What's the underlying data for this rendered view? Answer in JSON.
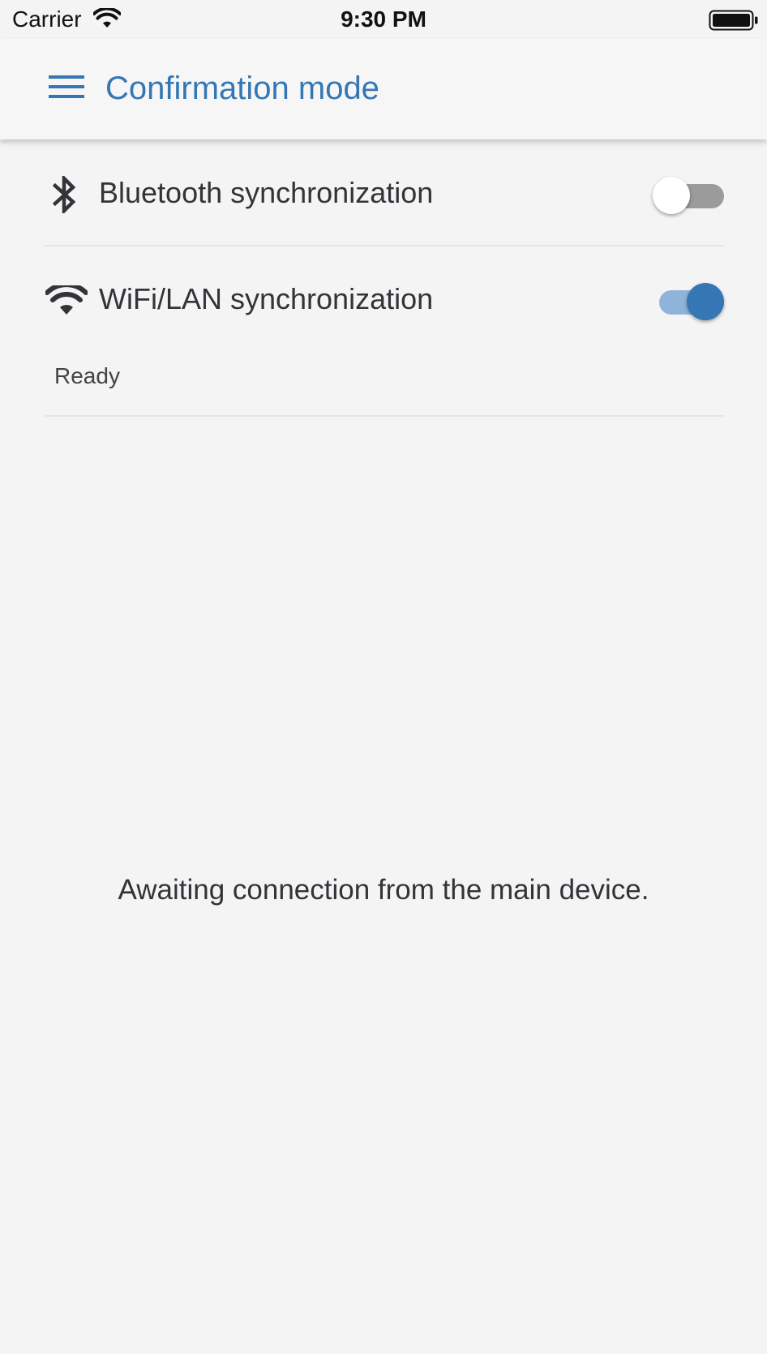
{
  "status_bar": {
    "carrier": "Carrier",
    "time": "9:30 PM",
    "wifi_icon": "wifi-icon",
    "battery_icon": "battery-icon"
  },
  "app_bar": {
    "menu_icon": "menu-icon",
    "title": "Confirmation mode",
    "title_color": "#3577b4"
  },
  "sync": {
    "bluetooth": {
      "icon": "bluetooth-icon",
      "label": "Bluetooth synchronization",
      "enabled": false
    },
    "wifi": {
      "icon": "wifi-icon",
      "label": "WiFi/LAN synchronization",
      "enabled": true,
      "status": "Ready"
    }
  },
  "message": "Awaiting connection from the main device.",
  "colors": {
    "accent": "#3577b4",
    "toggle_on_track": "#8fb4d9",
    "toggle_off_track": "#9b9b9b",
    "toggle_off_thumb": "#ffffff",
    "background": "#f4f4f5"
  }
}
